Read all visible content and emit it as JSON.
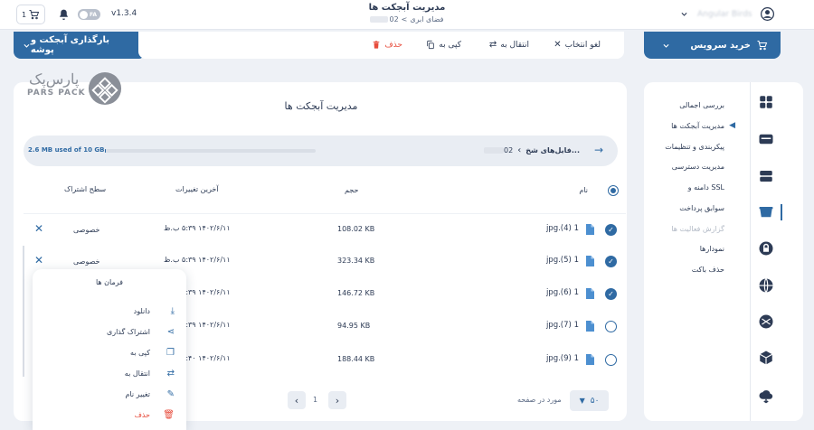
{
  "topbar": {
    "version": "v1.3.4",
    "fa_toggle": "FA",
    "cart_count": "1",
    "title": "مدیریت آبجکت ها",
    "breadcrumb_root": "فضای ابری",
    "breadcrumb_sep": "<",
    "bucket_name": "02",
    "user_name": "Angular Birds"
  },
  "toolbar": {
    "deselect": "لغو انتخاب",
    "move_to": "انتقال به",
    "copy_to": "کپی به",
    "delete": "حذف"
  },
  "buy_service": "خرید سرویس",
  "upload_button": "بارگذاری آبجکت و پوشه",
  "logo": {
    "fa": "پارس‌پک",
    "en": "PARS PACK"
  },
  "sidebar": {
    "items": [
      {
        "label": "بررسی اجمالی",
        "state": "normal"
      },
      {
        "label": "مدیریت آبجکت ها",
        "state": "active"
      },
      {
        "label": "پیکربندی و تنظیمات",
        "state": "normal"
      },
      {
        "label": "مدیریت دسترسی",
        "state": "normal"
      },
      {
        "label": "دامنه و SSL",
        "state": "normal"
      },
      {
        "label": "سوابق پرداخت",
        "state": "normal"
      },
      {
        "label": "گزارش فعالیت ها",
        "state": "disabled"
      },
      {
        "label": "نمودارها",
        "state": "normal"
      },
      {
        "label": "حذف باکت",
        "state": "normal"
      }
    ]
  },
  "main": {
    "title": "مدیریت آبجکت ها",
    "path_bucket": "02",
    "path_folder": "فایل‌های شخ...",
    "storage_used": "2.6 MB used of 10 GB",
    "storage_fraction": 0.00026,
    "columns": {
      "name": "نام",
      "size": "حجم",
      "modified": "آخرین تغییرات",
      "share": "سطح اشتراک"
    },
    "rows": [
      {
        "name": "1 (4).jpg",
        "size": "108.02 KB",
        "modified": "۱۴۰۲/۶/۱۱ ۵:۳۹ ب.ظ",
        "share": "خصوصی",
        "checked": true
      },
      {
        "name": "1 (5).jpg",
        "size": "323.34 KB",
        "modified": "۱۴۰۲/۶/۱۱ ۵:۳۹ ب.ظ",
        "share": "خصوصی",
        "checked": true
      },
      {
        "name": "1 (6).jpg",
        "size": "146.72 KB",
        "modified": "۱۴۰۲/۶/۱۱ ۵:۳۹ ب.ظ",
        "share": "",
        "checked": true
      },
      {
        "name": "1 (7).jpg",
        "size": "94.95 KB",
        "modified": "۱۴۰۲/۶/۱۱ ۵:۳۹ ب.ظ",
        "share": "",
        "checked": false
      },
      {
        "name": "1 (9).jpg",
        "size": "188.44 KB",
        "modified": "۱۴۰۲/۶/۱۱ ۵:۴۰ ب.ظ",
        "share": "",
        "checked": false
      }
    ],
    "pagination": {
      "per_page": "۵۰",
      "per_page_label": "مورد در صفحه",
      "page": "1"
    }
  },
  "context_menu": {
    "title": "فرمان ها",
    "items": [
      {
        "label": "دانلود",
        "icon": "download-icon"
      },
      {
        "label": "اشتراک گذاری",
        "icon": "share-icon"
      },
      {
        "label": "کپی به",
        "icon": "copy-icon"
      },
      {
        "label": "انتقال به",
        "icon": "swap-icon"
      },
      {
        "label": "تغییر نام",
        "icon": "pencil-icon"
      },
      {
        "label": "حذف",
        "icon": "trash-icon"
      }
    ]
  },
  "colors": {
    "accent": "#2f6aa3",
    "danger": "#e74c3c",
    "check": "#2f6aa3"
  }
}
